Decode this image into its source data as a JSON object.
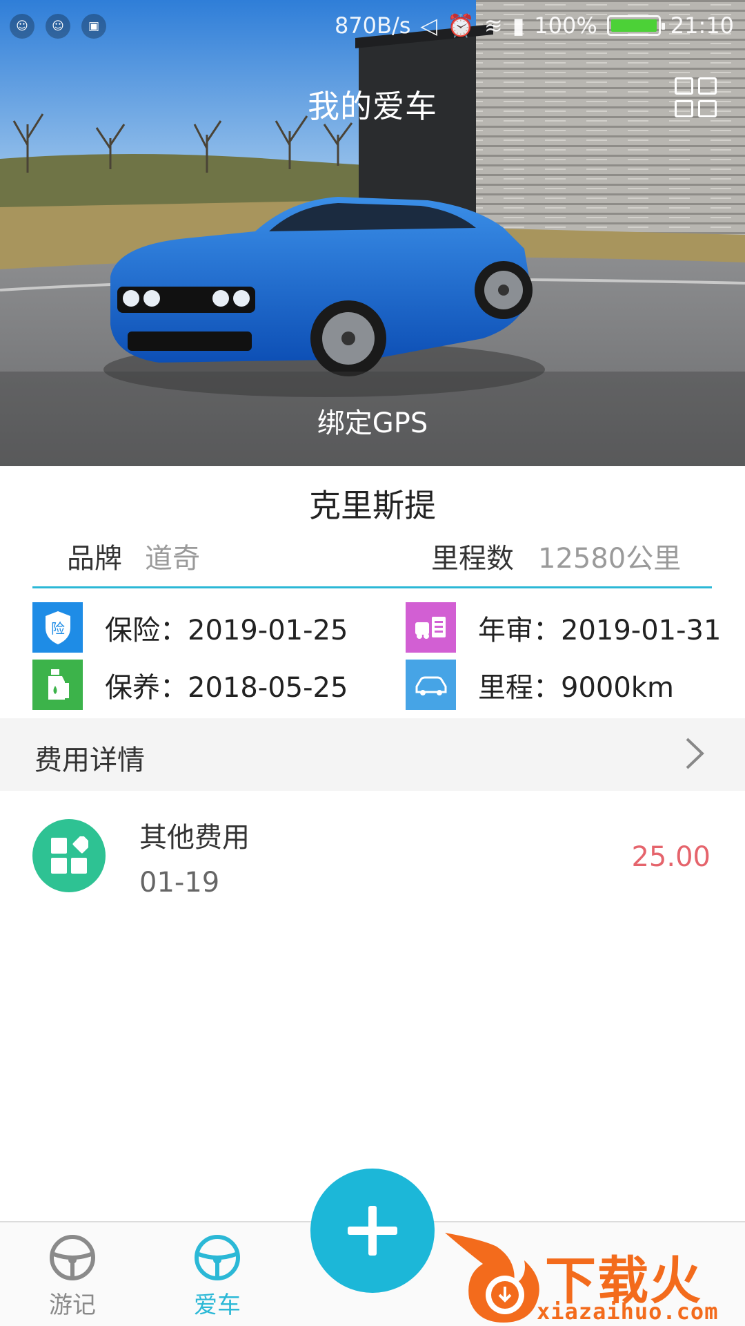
{
  "status_bar": {
    "net_speed": "870B/s",
    "battery_percent": "100%",
    "battery_level": 1.0,
    "time": "21:10",
    "left_icons": [
      "notification-icon",
      "notification-icon",
      "screenshot-icon"
    ],
    "right_icons": [
      "mute-icon",
      "alarm-icon",
      "wifi-icon",
      "signal-icon"
    ]
  },
  "header": {
    "title": "我的爱车",
    "right_icon": "grid-icon"
  },
  "hero": {
    "gps_label": "绑定GPS",
    "image_subject": "blue-muscle-car-photo"
  },
  "car": {
    "name": "克里斯提",
    "brand_label": "品牌",
    "brand_value": "道奇",
    "mileage_label": "里程数",
    "mileage_value": "12580公里"
  },
  "reminders": [
    {
      "icon": "insurance-icon",
      "icon_glyph": "险",
      "color": "#1e8ce6",
      "text": "保险：2019-01-25"
    },
    {
      "icon": "inspection-icon",
      "color": "#d25fd3",
      "text": "年审：2019-01-31"
    },
    {
      "icon": "maintenance-icon",
      "color": "#3cb34a",
      "text": "保养：2018-05-25"
    },
    {
      "icon": "car-icon",
      "color": "#46a4e6",
      "text": "里程：9000km"
    }
  ],
  "expenses": {
    "header": "费用详情",
    "items": [
      {
        "icon": "other-expense-icon",
        "name": "其他费用",
        "date": "01-19",
        "amount": "25.00"
      }
    ]
  },
  "bottom_nav": {
    "items": [
      {
        "icon": "steering-wheel-icon",
        "label": "游记",
        "active": false
      },
      {
        "icon": "steering-wheel-icon",
        "label": "爱车",
        "active": true
      }
    ],
    "fab_icon": "plus-icon"
  },
  "watermark": {
    "text": "下载火",
    "domain": "xiazaihuo.com"
  },
  "colors": {
    "accent": "#2bb8d6",
    "fab": "#1cb7d8",
    "amount": "#e5646c",
    "expense_icon_bg": "#2ec293"
  }
}
